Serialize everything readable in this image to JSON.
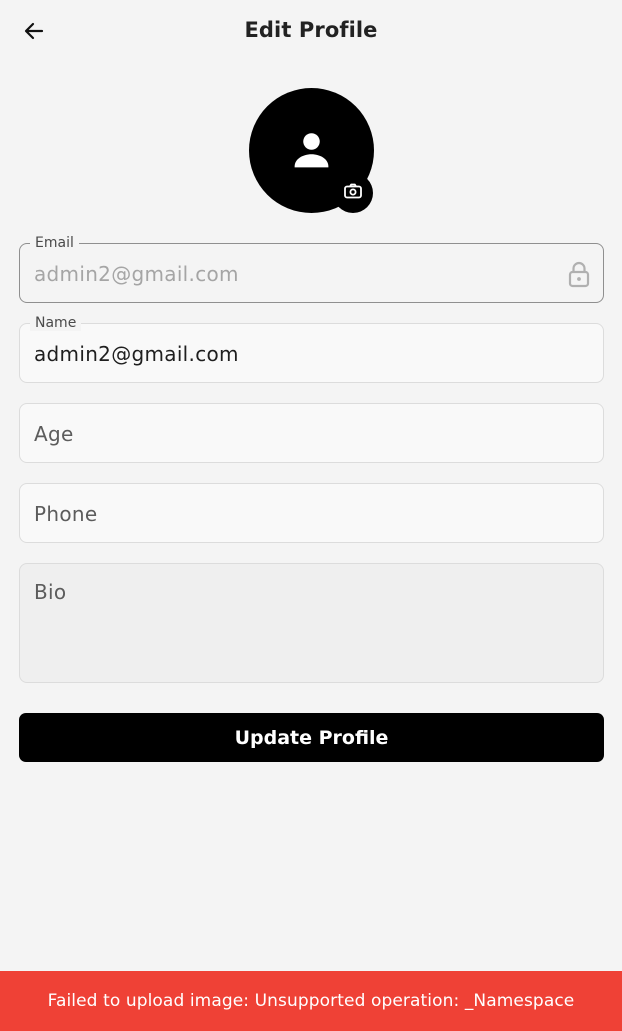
{
  "appbar": {
    "title": "Edit Profile",
    "back_icon": "arrow-left-icon"
  },
  "avatar": {
    "icon": "person-icon",
    "badge_icon": "camera-icon"
  },
  "form": {
    "email": {
      "label": "Email",
      "value": "admin2@gmail.com",
      "icon": "lock-icon"
    },
    "name": {
      "label": "Name",
      "value": "admin2@gmail.com"
    },
    "age": {
      "placeholder": "Age",
      "value": ""
    },
    "phone": {
      "placeholder": "Phone",
      "value": ""
    },
    "bio": {
      "placeholder": "Bio",
      "value": ""
    },
    "submit_label": "Update Profile"
  },
  "snackbar": {
    "message": "Failed to upload image: Unsupported operation: _Namespace"
  },
  "colors": {
    "background": "#f4f4f4",
    "primary": "#000000",
    "error": "#ef4136"
  }
}
